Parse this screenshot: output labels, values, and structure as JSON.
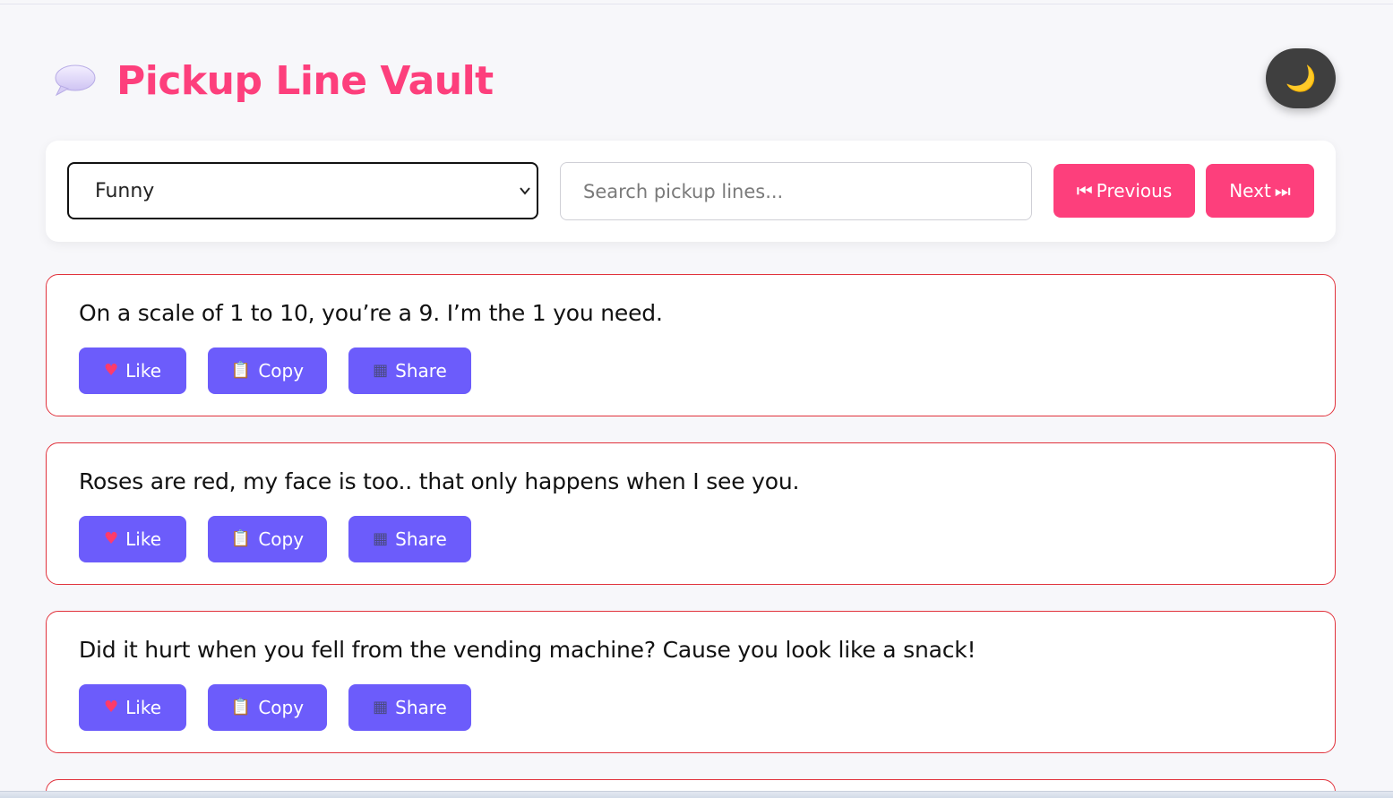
{
  "header": {
    "title": "Pickup Line Vault",
    "logo_icon": "speech-bubble-icon",
    "theme_toggle_glyph": "🌙",
    "theme_toggle_icon": "moon-icon"
  },
  "controls": {
    "category_selected": "Funny",
    "search_placeholder": "Search pickup lines...",
    "search_value": "",
    "previous_label": "Previous",
    "previous_glyph": "⏮",
    "next_label": "Next",
    "next_glyph": "⏭"
  },
  "actions": {
    "like_label": "Like",
    "like_glyph": "♥",
    "copy_label": "Copy",
    "copy_glyph": "📋",
    "share_label": "Share",
    "share_glyph": "▦"
  },
  "lines": [
    {
      "text": "On a scale of 1 to 10, you’re a 9. I’m the 1 you need."
    },
    {
      "text": "Roses are red, my face is too.. that only happens when I see you."
    },
    {
      "text": "Did it hurt when you fell from the vending machine? Cause you look like a snack!"
    }
  ],
  "colors": {
    "brand_pink": "#fd3f7c",
    "action_purple": "#6c5cfb",
    "card_border": "#e1323c",
    "toggle_bg": "#3f3f3f"
  }
}
